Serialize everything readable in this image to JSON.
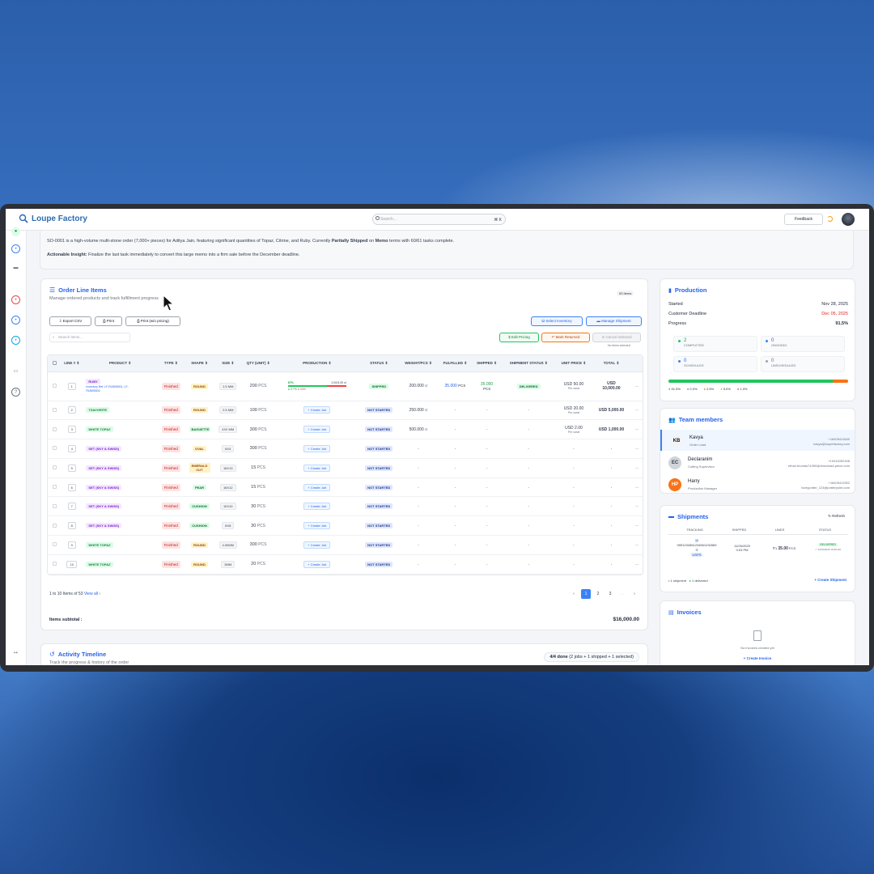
{
  "app": {
    "title": "Loupe Factory",
    "search_placeholder": "Search...",
    "search_shortcut": "⌘ K",
    "feedback_label": "Feedback"
  },
  "insight": {
    "s1": "SO-0001 is a high-volume multi-stone order (7,000+ pieces) for Aditya Jain, featuring significant quantities of Topaz, Citrine, and Ruby. Currently ",
    "s2": "Partially Shipped",
    "s3": " on ",
    "s4": "Memo",
    "s5": " terms with 60/61 tasks complete.",
    "action_label": "Actionable Insight:",
    "action_text": "Finalize the last task immediately to convert this large memo into a firm sale before the December deadline."
  },
  "line_items": {
    "title": "Order Line Items",
    "subtitle": "Manage ordered products and track fulfillment progress",
    "count_badge": "53 Items",
    "btn_export": "Export CSV",
    "btn_print": "Print",
    "btn_print_wo": "Print (w/o pricing)",
    "btn_select_inventory": "Select Inventory",
    "btn_manage_shipment": "Manage Shipment",
    "search_placeholder": "Search items...",
    "btn_edit_pricing": "Edit Pricing",
    "btn_mark_returned": "Mark Returned",
    "btn_cancel_selected": "Cancel selected",
    "no_selection": "No items selected",
    "columns": [
      "",
      "LINE #",
      "PRODUCT",
      "TYPE",
      "SHAPE",
      "SIZE",
      "QTY (UNIT)",
      "PRODUCTION",
      "STATUS",
      "WEIGHT/PCS",
      "FULFILLED",
      "SHIPPED",
      "SHIPMENT STATUS",
      "UNIT PRICE",
      "TOTAL",
      ""
    ],
    "rows": [
      {
        "line": "1",
        "product": "RUBY",
        "sub": "Inventory Ref: LF-RUB05001, LF-RUB05002",
        "ptype": "purple",
        "type": "Finished",
        "shape": "ROUND",
        "size": "1.5 MM",
        "qty": "200",
        "unit": "PCS",
        "production": {
          "pct": "67%",
          "ratio": "2.00/3.00 ct",
          "done": 0.67,
          "l1": "0.7%",
          "l2": "33%"
        },
        "status": "SHIPPED",
        "weight": "200.000",
        "wunit": "ct",
        "fulfilled": "35.000",
        "funit": "PCS",
        "shipped": "35.000",
        "sunit": "PCS",
        "ship_status": "DELIVERED",
        "price": "USD 50.00",
        "per": "Per carat",
        "total": "USD 10,000.00"
      },
      {
        "line": "2",
        "product": "TSAVORITE",
        "ptype": "green",
        "type": "Finished",
        "shape": "ROUND",
        "size": "2.5 MM",
        "qty": "100",
        "unit": "PCS",
        "status": "NOT STARTED",
        "weight": "250.000",
        "wunit": "ct",
        "price": "USD 20.00",
        "per": "Per carat",
        "total": "USD 5,000.00"
      },
      {
        "line": "3",
        "product": "WHITE TOPAZ",
        "ptype": "green",
        "type": "Finished",
        "shape": "BAGUETTE",
        "size": "4X2 MM",
        "qty": "300",
        "unit": "PCS",
        "status": "NOT STARTED",
        "weight": "500.000",
        "wunit": "ct",
        "price": "USD 2.00",
        "per": "Per carat",
        "total": "USD 1,000.00"
      },
      {
        "line": "4",
        "product": "SET (SKY & SWISS)",
        "ptype": "purple",
        "type": "Finished",
        "shape": "OVAL",
        "size": "6X4",
        "qty": "300",
        "unit": "PCS",
        "status": "NOT STARTED"
      },
      {
        "line": "5",
        "product": "SET (SKY & SWISS)",
        "ptype": "purple",
        "type": "Finished",
        "shape": "EMERALD CUT",
        "size": "16X13",
        "qty": "15",
        "unit": "PCS",
        "status": "NOT STARTED"
      },
      {
        "line": "6",
        "product": "SET (SKY & SWISS)",
        "ptype": "purple",
        "type": "Finished",
        "shape": "PEAR",
        "size": "16X12",
        "qty": "15",
        "unit": "PCS",
        "status": "NOT STARTED"
      },
      {
        "line": "7",
        "product": "SET (SKY & SWISS)",
        "ptype": "purple",
        "type": "Finished",
        "shape": "CUSHION",
        "size": "10X10",
        "qty": "30",
        "unit": "PCS",
        "status": "NOT STARTED"
      },
      {
        "line": "8",
        "product": "SET (SKY & SWISS)",
        "ptype": "purple",
        "type": "Finished",
        "shape": "CUSHION",
        "size": "8X8",
        "qty": "30",
        "unit": "PCS",
        "status": "NOT STARTED"
      },
      {
        "line": "9",
        "product": "WHITE TOPAZ",
        "ptype": "green",
        "type": "Finished",
        "shape": "ROUND",
        "size": "4.00MM",
        "qty": "300",
        "unit": "PCS",
        "status": "NOT STARTED"
      },
      {
        "line": "10",
        "product": "WHITE TOPAZ",
        "ptype": "green",
        "type": "Finished",
        "shape": "ROUND",
        "size": "3MM",
        "qty": "20",
        "unit": "PCS",
        "status": "NOT STARTED"
      }
    ],
    "create_job": "+ Create Job",
    "dash": "-",
    "row_menu": "···",
    "pagination_summary": "1 to 10 Items of 53",
    "view_all": "View all ›",
    "pages": [
      "1",
      "2",
      "3"
    ],
    "subtotal_label": "Items subtotal :",
    "subtotal_value": "$16,000.00"
  },
  "timeline": {
    "title": "Activity Timeline",
    "subtitle": "Track the progress & history of the order",
    "done": "4/4 done",
    "detail": "(2 jobs + 1 shipped + 1 selected)"
  },
  "production": {
    "title": "Production",
    "started_label": "Started",
    "started_value": "Nov 28, 2025",
    "deadline_label": "Customer Deadline",
    "deadline_value": "Dec 05, 2025",
    "progress_label": "Progress",
    "progress_value": "91.5%",
    "progress_fraction": 0.915,
    "stats": [
      {
        "value": "2",
        "label": "COMPLETED"
      },
      {
        "value": "0",
        "label": "ONGOING"
      },
      {
        "value": "0",
        "label": "SCHEDULED"
      },
      {
        "value": "0",
        "label": "UNSCHEDULED"
      }
    ],
    "legend": [
      {
        "value": "91.5%",
        "color": "#22c55e"
      },
      {
        "value": "0.0%",
        "color": "#3b82f6"
      },
      {
        "value": "2.5%",
        "color": "#f97316"
      },
      {
        "value": "5.0%",
        "color": "#f59e0b"
      },
      {
        "value": "1.0%",
        "color": "#ef4444"
      }
    ]
  },
  "team": {
    "title": "Team members",
    "members": [
      {
        "initials": "KB",
        "name": "Kavya",
        "role": "Order Lead",
        "phone": "+16405411640",
        "email": "kavya@loupefactory.com",
        "bg": "#f3f4f6",
        "fg": "#111827"
      },
      {
        "initials": "EC",
        "name": "Declaranim",
        "role": "Cutting Supervisor",
        "phone": "+19414052348",
        "email": "ethan.thomas74390@download-piece.com",
        "bg": "#d1d5db",
        "fg": "#374151"
      },
      {
        "initials": "HP",
        "name": "Harry",
        "role": "Production Manager",
        "phone": "+16405411952",
        "email": "harrypotter_123@potterpoint.com",
        "bg": "#f97316",
        "fg": "#ffffff"
      }
    ]
  },
  "shipments": {
    "title": "Shipments",
    "refresh": "Refresh",
    "headers": [
      "TRACKING",
      "SHIPPED",
      "LINES",
      "STATUS"
    ],
    "row": {
      "tracking": "9991234561234561234569",
      "carrier": "USPS",
      "date": "11/26/2025",
      "time": "3:03 PM",
      "lines": "35.00",
      "unit": "PCS",
      "status": "DELIVERED",
      "status_time": "✓ 12/03/2025 10:08 AM"
    },
    "summary_shipments": "1 shipment",
    "summary_delivered": "1 delivered",
    "create": "Create Shipment"
  },
  "invoices": {
    "title": "Invoices",
    "empty": "No invoices created yet",
    "create": "Create Invoice"
  }
}
